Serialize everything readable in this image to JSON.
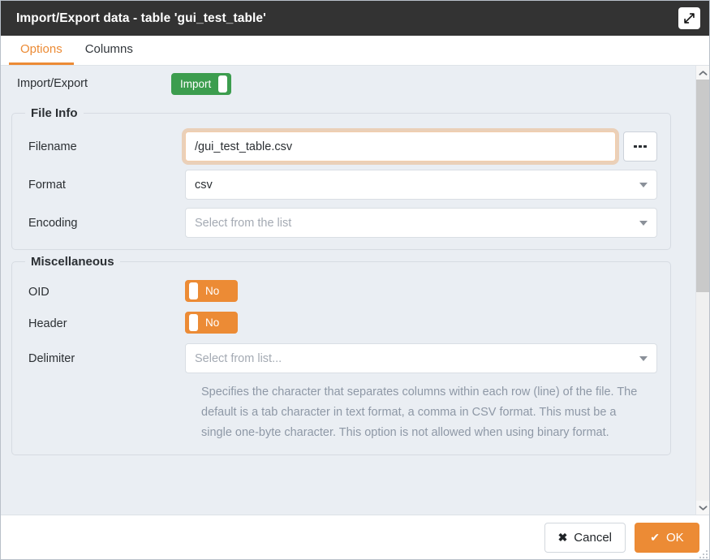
{
  "window": {
    "title": "Import/Export data - table 'gui_test_table'",
    "maximize_icon": "expand-diagonal-icon"
  },
  "tabs": [
    {
      "label": "Options",
      "active": true
    },
    {
      "label": "Columns",
      "active": false
    }
  ],
  "form": {
    "mode_row": {
      "label": "Import/Export",
      "toggle_label": "Import",
      "state": "on"
    },
    "file_info": {
      "legend": "File Info",
      "filename": {
        "label": "Filename",
        "value": "/gui_test_table.csv",
        "placeholder": "",
        "browse_icon": "ellipsis-icon"
      },
      "format": {
        "label": "Format",
        "value": "csv",
        "placeholder": "Select from the list"
      },
      "encoding": {
        "label": "Encoding",
        "value": "",
        "placeholder": "Select from the list"
      }
    },
    "miscellaneous": {
      "legend": "Miscellaneous",
      "oid": {
        "label": "OID",
        "toggle_label": "No",
        "state": "off"
      },
      "header": {
        "label": "Header",
        "toggle_label": "No",
        "state": "off"
      },
      "delimiter": {
        "label": "Delimiter",
        "value": "",
        "placeholder": "Select from list...",
        "help": "Specifies the character that separates columns within each row (line) of the file. The default is a tab character in text format, a comma in CSV format. This must be a single one-byte character. This option is not allowed when using binary format."
      }
    }
  },
  "scrollbar": {
    "up_icon": "chevron-up-icon",
    "down_icon": "chevron-down-icon"
  },
  "footer": {
    "cancel": {
      "label": "Cancel",
      "glyph": "✖"
    },
    "ok": {
      "label": "OK",
      "glyph": "✔"
    }
  },
  "colors": {
    "titlebar": "#333333",
    "accent": "#ec8b35",
    "toggle_on": "#3c9d4e",
    "toggle_off": "#ec8b35",
    "body": "#eaeef3"
  }
}
